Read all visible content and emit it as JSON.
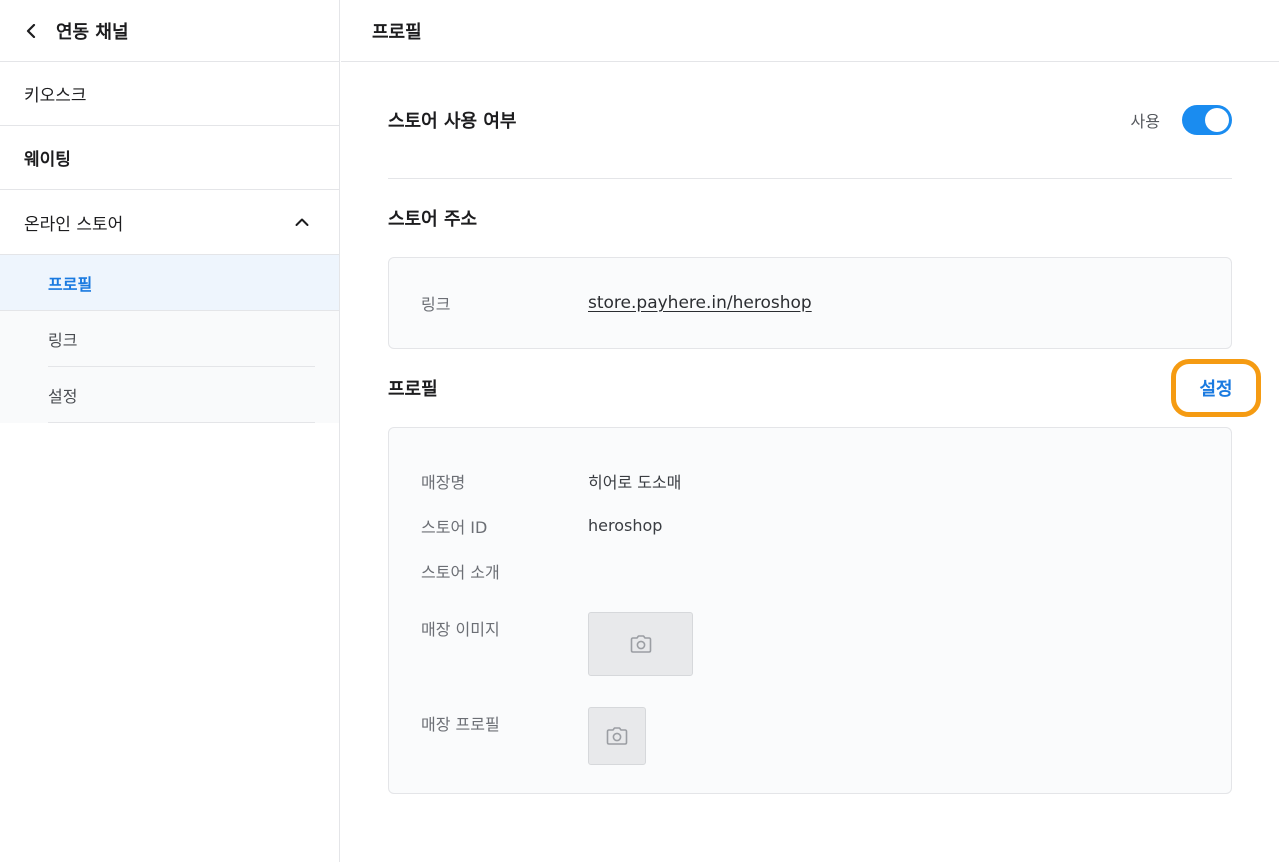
{
  "sidebar": {
    "back_icon": "chevron-left-icon",
    "title": "연동 채널",
    "items": [
      {
        "label": "키오스크"
      },
      {
        "label": "웨이팅"
      },
      {
        "label": "온라인 스토어",
        "expanded": true,
        "icon": "chevron-up-icon"
      }
    ],
    "sub_items": [
      {
        "label": "프로필",
        "active": true
      },
      {
        "label": "링크"
      },
      {
        "label": "설정"
      }
    ]
  },
  "main": {
    "title": "프로필",
    "usage": {
      "title": "스토어 사용 여부",
      "status_label": "사용",
      "toggle_on": true
    },
    "address": {
      "title": "스토어 주소",
      "link_label": "링크",
      "link_value": "store.payhere.in/heroshop"
    },
    "profile": {
      "title": "프로필",
      "setting_button": "설정",
      "store_name_label": "매장명",
      "store_name_value": "히어로 도소매",
      "store_id_label": "스토어 ID",
      "store_id_value": "heroshop",
      "store_intro_label": "스토어 소개",
      "store_image_label": "매장 이미지",
      "store_profile_label": "매장 프로필",
      "image_icon": "camera-icon"
    }
  },
  "colors": {
    "accent": "#1a7ae0",
    "toggle": "#1a8cf0",
    "highlight": "#f59b12"
  }
}
